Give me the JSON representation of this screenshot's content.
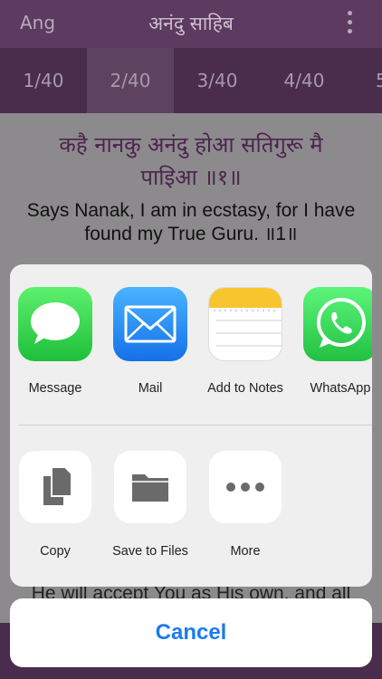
{
  "header": {
    "left_label": "Ang",
    "title": "अनंदु साहिब",
    "menu_icon": "vertical-dots-icon"
  },
  "tabs": [
    {
      "label": "1/40",
      "active": false
    },
    {
      "label": "2/40",
      "active": true
    },
    {
      "label": "3/40",
      "active": false
    },
    {
      "label": "4/40",
      "active": false
    },
    {
      "label": "5",
      "active": false
    }
  ],
  "content": {
    "gurmukhi_line1": "कहै नानकु अनंदु होआ सतिगुरू मै",
    "gurmukhi_line2": "पाइिआ ॥१॥",
    "english_line1": "Says Nanak, I am in ecstasy, for I have",
    "english_line2": "found my True Guru. ॥1॥",
    "partial_text": "He will accept You as His own, and all"
  },
  "share_sheet": {
    "apps": [
      {
        "label": "Message",
        "icon": "message-bubble-icon",
        "color": "#34c759"
      },
      {
        "label": "Mail",
        "icon": "envelope-icon",
        "color": "#1e8cf4"
      },
      {
        "label": "Add to Notes",
        "icon": "notes-icon",
        "color": "#f6c833"
      },
      {
        "label": "WhatsApp",
        "icon": "whatsapp-phone-icon",
        "color": "#25d366"
      }
    ],
    "actions": [
      {
        "label": "Copy",
        "icon": "copy-documents-icon"
      },
      {
        "label": "Save to Files",
        "icon": "folder-icon"
      },
      {
        "label": "More",
        "icon": "more-dots-icon"
      }
    ]
  },
  "cancel_label": "Cancel"
}
